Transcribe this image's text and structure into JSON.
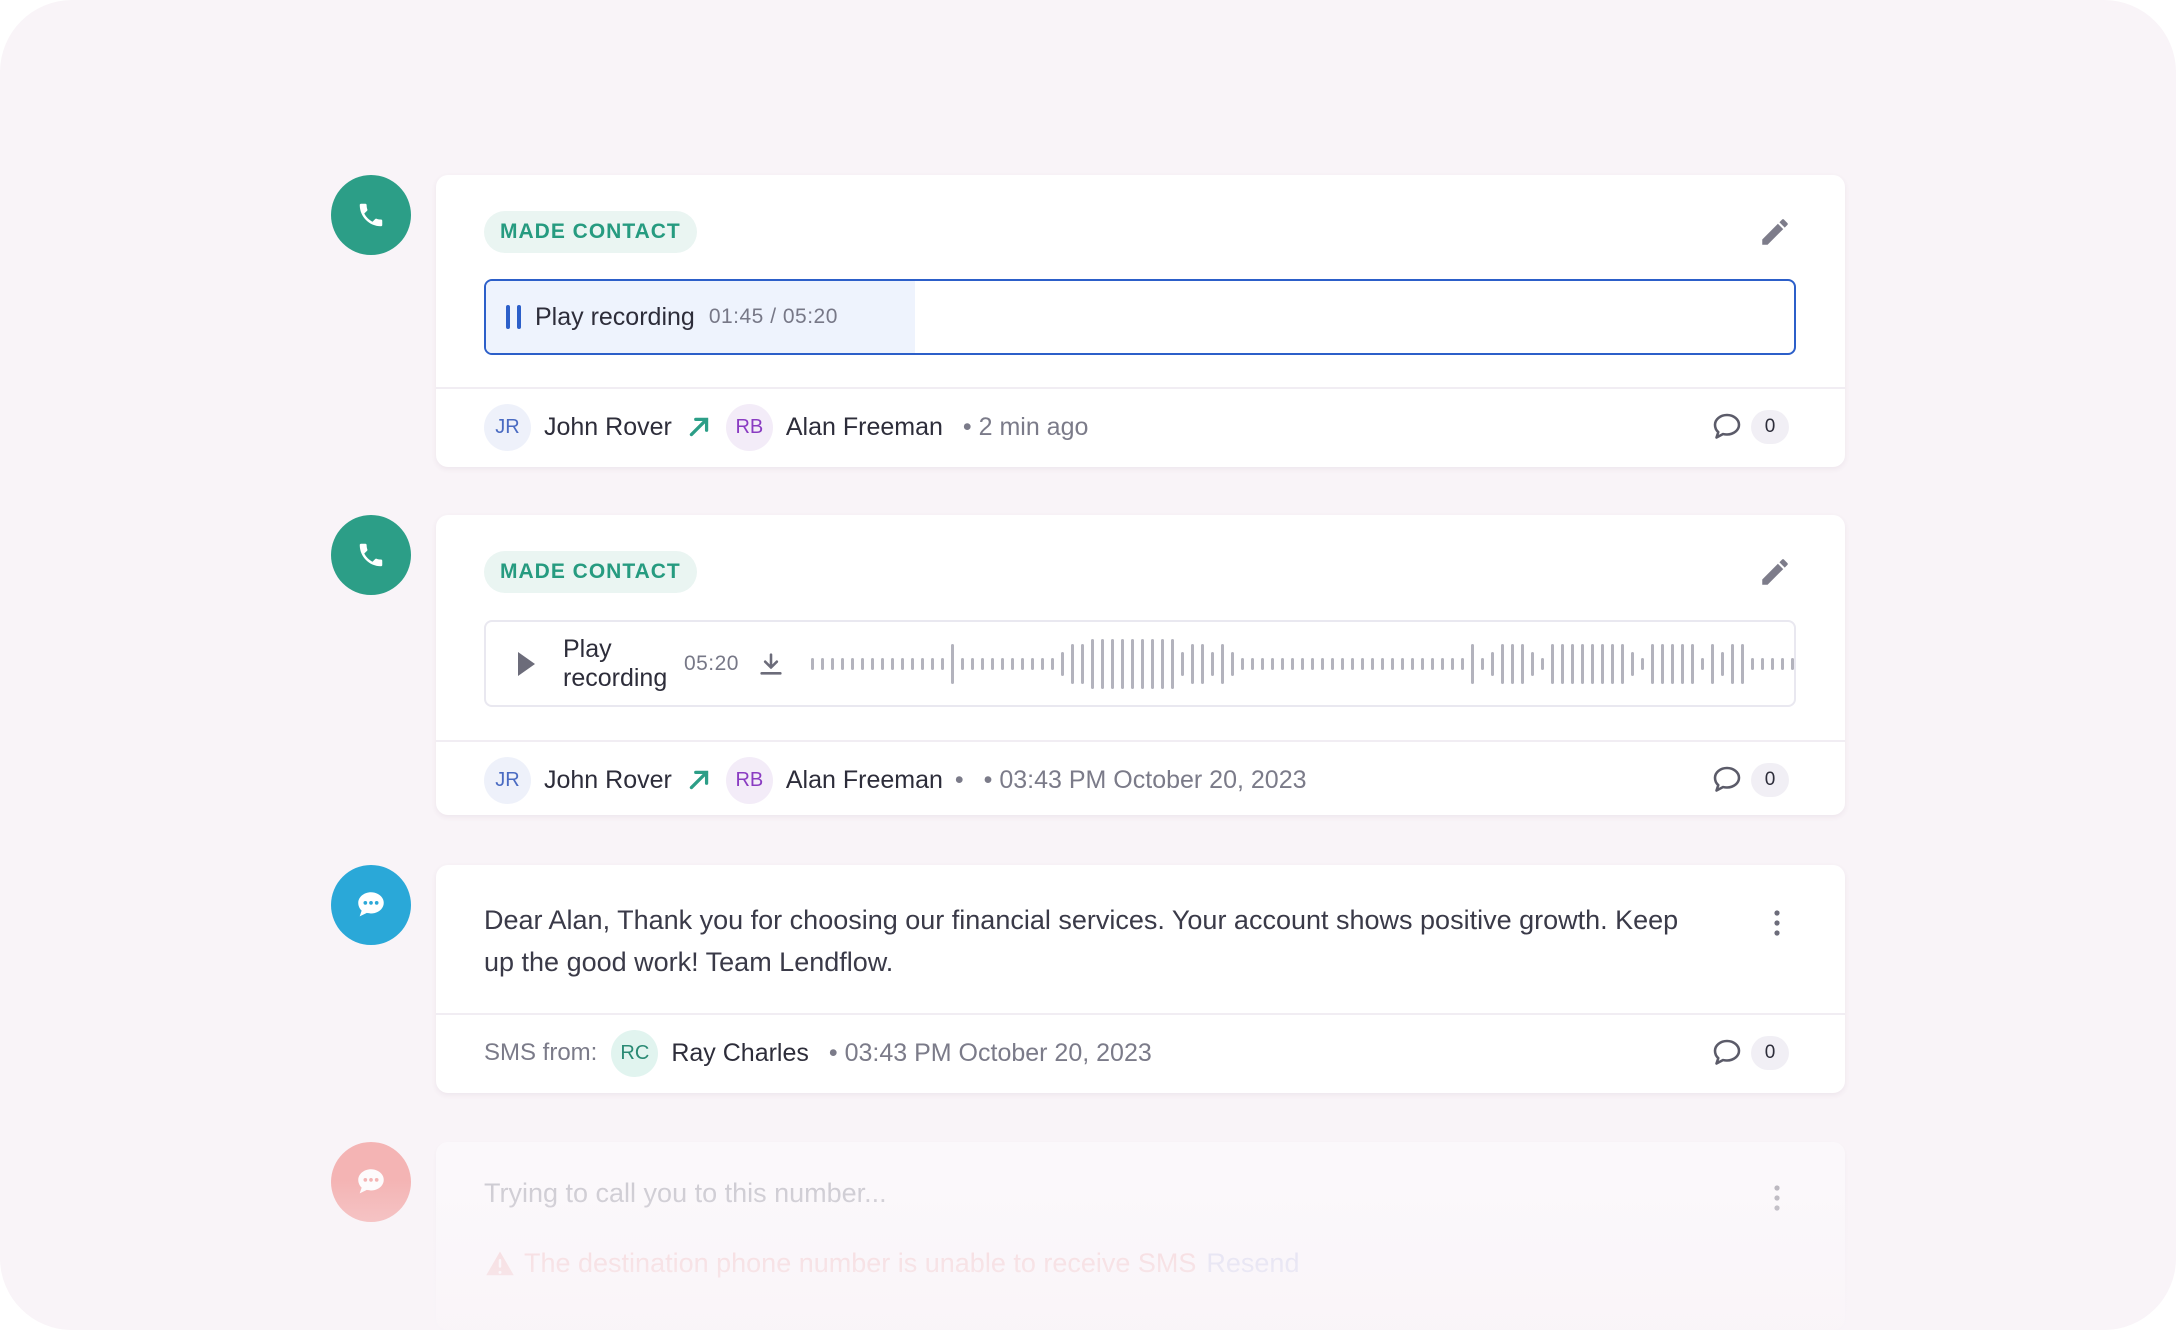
{
  "colors": {
    "page_background": "#f9f4f8",
    "call_icon": "#2c9e87",
    "sms_icon": "#2aa8d8",
    "failed_icon": "#f39a98",
    "accent": "#2c5fc9",
    "badge_text": "#269b80"
  },
  "activities": [
    {
      "type": "call",
      "icon": "phone-icon",
      "badge": "MADE CONTACT",
      "player": {
        "state": "playing",
        "label": "Play recording",
        "time": "01:45 / 05:20",
        "progress_fraction": 0.328
      },
      "caller": {
        "initials": "JR",
        "name": "John Rover"
      },
      "direction_icon": "arrow-up-right-icon",
      "recipient": {
        "initials": "RB",
        "name": "Alan Freeman"
      },
      "timestamp": "• 2 min ago",
      "comment_count": "0"
    },
    {
      "type": "call",
      "icon": "phone-icon",
      "badge": "MADE CONTACT",
      "player": {
        "state": "paused",
        "label": "Play recording",
        "time": "05:20"
      },
      "caller": {
        "initials": "JR",
        "name": "John Rover"
      },
      "direction_icon": "arrow-up-right-icon",
      "recipient": {
        "initials": "RB",
        "name": "Alan Freeman"
      },
      "separator": "•",
      "timestamp": "• 03:43 PM October 20, 2023",
      "comment_count": "0"
    },
    {
      "type": "sms",
      "icon": "chat-bubble-icon",
      "message": "Dear Alan, Thank you for choosing our financial services. Your account shows positive growth. Keep up the good work! Team Lendflow.",
      "from_label": "SMS from:",
      "sender": {
        "initials": "RC",
        "name": "Ray Charles"
      },
      "timestamp": "• 03:43 PM October 20, 2023",
      "comment_count": "0"
    },
    {
      "type": "sms-failed",
      "icon": "chat-bubble-icon",
      "message": "Trying to call you to this number...",
      "error_icon": "warning-icon",
      "error": "The destination phone number is unable to receive SMS",
      "action": "Resend"
    }
  ]
}
